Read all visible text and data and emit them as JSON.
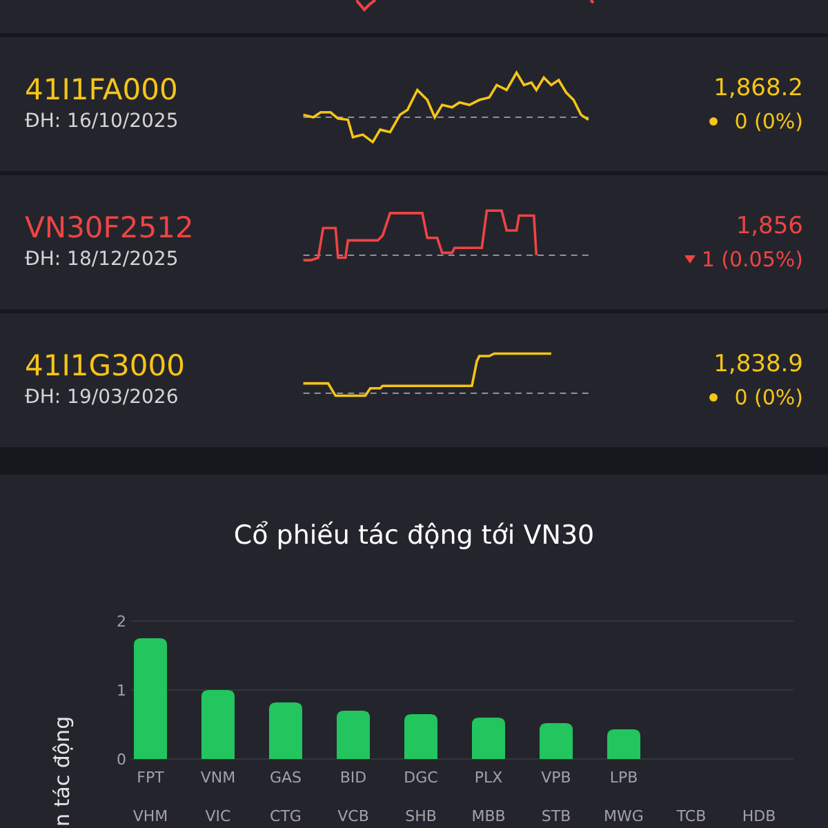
{
  "contracts": [
    {
      "symbol": "41I1FA000",
      "expiry": "ĐH: 16/10/2025",
      "price": "1,868.2",
      "change": "0 (0%)",
      "kind": "flat"
    },
    {
      "symbol": "VN30F2512",
      "expiry": "ĐH: 18/12/2025",
      "price": "1,856",
      "change": "1 (0.05%)",
      "kind": "down"
    },
    {
      "symbol": "41I1G3000",
      "expiry": "ĐH: 19/03/2026",
      "price": "1,838.9",
      "change": "0 (0%)",
      "kind": "flat"
    }
  ],
  "impact": {
    "title": "Cổ phiếu tác động tới VN30",
    "second_row_labels": [
      "VHM",
      "VIC",
      "CTG",
      "VCB",
      "SHB",
      "MBB",
      "STB",
      "MWG",
      "TCB",
      "HDB"
    ],
    "chart_data": {
      "type": "bar",
      "ylabel": "n tác động",
      "categories": [
        "FPT",
        "VNM",
        "GAS",
        "BID",
        "DGC",
        "PLX",
        "VPB",
        "LPB"
      ],
      "values": [
        1.75,
        1.0,
        0.82,
        0.7,
        0.65,
        0.6,
        0.52,
        0.43
      ],
      "ylim": [
        0,
        2
      ],
      "yticks": [
        0,
        1,
        2
      ]
    }
  }
}
